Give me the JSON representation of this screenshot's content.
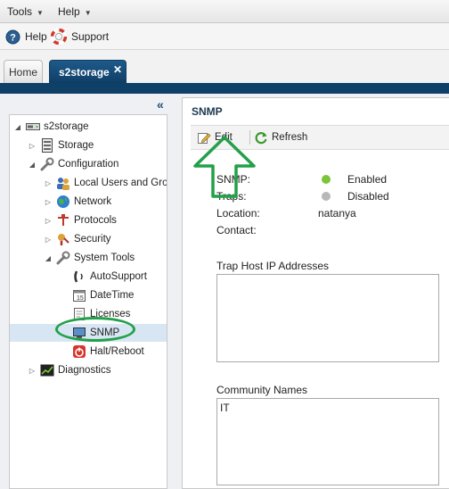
{
  "menubar": {
    "tools": "Tools",
    "help": "Help"
  },
  "toolbar": {
    "help": "Help",
    "support": "Support"
  },
  "tabs": {
    "home": "Home",
    "active": "s2storage",
    "close": "✕"
  },
  "tree": {
    "collapse": "«",
    "root": "s2storage",
    "storage": "Storage",
    "configuration": "Configuration",
    "local_users": "Local Users and Groups",
    "network": "Network",
    "protocols": "Protocols",
    "security": "Security",
    "system_tools": "System Tools",
    "autosupport": "AutoSupport",
    "datetime": "DateTime",
    "licenses": "Licenses",
    "snmp": "SNMP",
    "halt_reboot": "Halt/Reboot",
    "diagnostics": "Diagnostics"
  },
  "panel": {
    "title": "SNMP",
    "edit": "Edit",
    "refresh": "Refresh",
    "snmp_label": "SNMP:",
    "snmp_value": "Enabled",
    "snmp_color": "#7cc43a",
    "traps_label": "Traps:",
    "traps_value": "Disabled",
    "traps_color": "#b8b8b8",
    "location_label": "Location:",
    "location_value": "natanya",
    "contact_label": "Contact:",
    "contact_value": "",
    "trap_hosts_label": "Trap Host IP Addresses",
    "community_label": "Community Names",
    "community_value": "IT"
  },
  "annotations": {
    "color": "#22a04a"
  }
}
